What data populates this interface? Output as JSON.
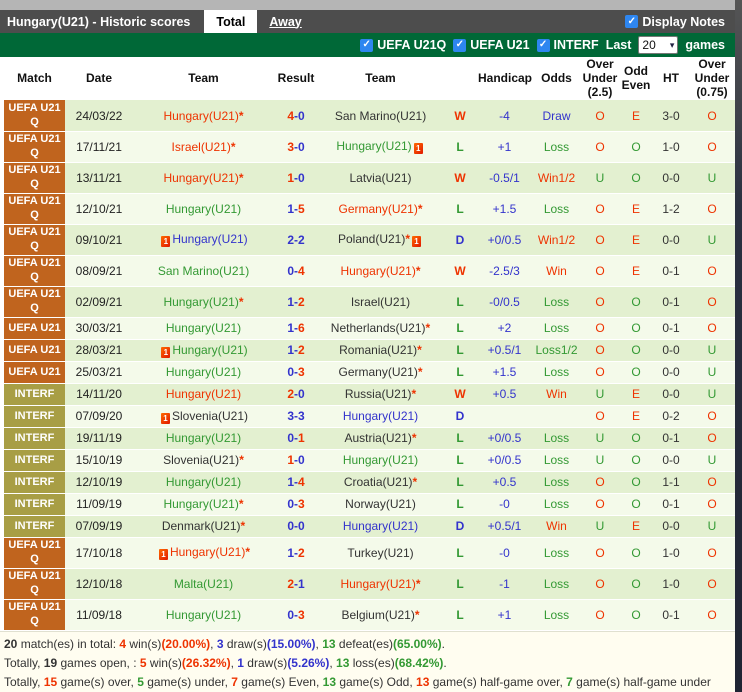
{
  "palette": {
    "red": "#ee3300",
    "green": "#339933",
    "blue": "#3333cc",
    "dark": "#333333",
    "label_orange": "#c0641e",
    "label_olive": "#a89e45",
    "title_bar": "#4d4d4d",
    "green_bar": "#006837",
    "check_blue": "#2e86f0",
    "row_dark": "#e3f0d0",
    "row_light": "#f4faea"
  },
  "icons": {
    "check": "✓",
    "select_arrow": "▾",
    "red_card_label": "1"
  },
  "header": {
    "title": "Hungary(U21) - Historic scores",
    "tabs": [
      {
        "label": "Total",
        "active": true
      },
      {
        "label": "Away",
        "active": false
      }
    ],
    "display_notes_label": "Display Notes"
  },
  "filters": {
    "items": [
      {
        "label": "UEFA U21Q",
        "checked": true
      },
      {
        "label": "UEFA U21",
        "checked": true
      },
      {
        "label": "INTERF",
        "checked": true
      }
    ],
    "last_label": "Last",
    "last_value": "20",
    "games_label": "games"
  },
  "table": {
    "columns": [
      "Match",
      "Date",
      "Team",
      "Result",
      "Team",
      "",
      "Handicap",
      "Odds",
      "Over Under (2.5)",
      "Odd Even",
      "HT",
      "Over Under (0.75)"
    ]
  },
  "rows": [
    {
      "comp": "UEFA U21 Q",
      "comp_style": "q",
      "date": "24/03/22",
      "home": {
        "name": "Hungary(U21)",
        "color": "red",
        "star": "*"
      },
      "score": {
        "home": "4",
        "away": "0",
        "home_color": "red",
        "away_color": "blue"
      },
      "away": {
        "name": "San Marino(U21)",
        "color": "dark"
      },
      "wld": {
        "text": "W",
        "color": "red"
      },
      "handicap": "-4",
      "odds": {
        "text": "Draw",
        "color": "blue"
      },
      "ou25": "O",
      "oe": "E",
      "ht": "3-0",
      "ou075": "O"
    },
    {
      "comp": "UEFA U21 Q",
      "comp_style": "q",
      "date": "17/11/21",
      "home": {
        "name": "Israel(U21)",
        "color": "red",
        "star": "*"
      },
      "score": {
        "home": "3",
        "away": "0",
        "home_color": "red",
        "away_color": "blue"
      },
      "away": {
        "name": "Hungary(U21)",
        "color": "green",
        "card_after": true
      },
      "wld": {
        "text": "L",
        "color": "green"
      },
      "handicap": "+1",
      "odds": {
        "text": "Loss",
        "color": "green"
      },
      "ou25": "O",
      "oe": "O",
      "ht": "1-0",
      "ou075": "O"
    },
    {
      "comp": "UEFA U21 Q",
      "comp_style": "q",
      "date": "13/11/21",
      "home": {
        "name": "Hungary(U21)",
        "color": "red",
        "star": "*"
      },
      "score": {
        "home": "1",
        "away": "0",
        "home_color": "red",
        "away_color": "blue"
      },
      "away": {
        "name": "Latvia(U21)",
        "color": "dark"
      },
      "wld": {
        "text": "W",
        "color": "red"
      },
      "handicap": "-0.5/1",
      "odds": {
        "text": "Win1/2",
        "color": "red"
      },
      "ou25": "U",
      "oe": "O",
      "ht": "0-0",
      "ou075": "U"
    },
    {
      "comp": "UEFA U21 Q",
      "comp_style": "q",
      "date": "12/10/21",
      "home": {
        "name": "Hungary(U21)",
        "color": "green"
      },
      "score": {
        "home": "1",
        "away": "5",
        "home_color": "blue",
        "away_color": "red"
      },
      "away": {
        "name": "Germany(U21)",
        "color": "red",
        "star": "*"
      },
      "wld": {
        "text": "L",
        "color": "green"
      },
      "handicap": "+1.5",
      "odds": {
        "text": "Loss",
        "color": "green"
      },
      "ou25": "O",
      "oe": "E",
      "ht": "1-2",
      "ou075": "O"
    },
    {
      "comp": "UEFA U21 Q",
      "comp_style": "q",
      "date": "09/10/21",
      "home": {
        "name": "Hungary(U21)",
        "color": "blue",
        "card_before": true
      },
      "score": {
        "home": "2",
        "away": "2",
        "home_color": "blue",
        "away_color": "blue"
      },
      "away": {
        "name": "Poland(U21)",
        "color": "dark",
        "star": "*",
        "card_after": true
      },
      "wld": {
        "text": "D",
        "color": "blue"
      },
      "handicap": "+0/0.5",
      "odds": {
        "text": "Win1/2",
        "color": "red"
      },
      "ou25": "O",
      "oe": "E",
      "ht": "0-0",
      "ou075": "U"
    },
    {
      "comp": "UEFA U21 Q",
      "comp_style": "q",
      "date": "08/09/21",
      "home": {
        "name": "San Marino(U21)",
        "color": "green"
      },
      "score": {
        "home": "0",
        "away": "4",
        "home_color": "blue",
        "away_color": "red"
      },
      "away": {
        "name": "Hungary(U21)",
        "color": "red",
        "star": "*"
      },
      "wld": {
        "text": "W",
        "color": "red"
      },
      "handicap": "-2.5/3",
      "odds": {
        "text": "Win",
        "color": "red"
      },
      "ou25": "O",
      "oe": "E",
      "ht": "0-1",
      "ou075": "O"
    },
    {
      "comp": "UEFA U21 Q",
      "comp_style": "q",
      "date": "02/09/21",
      "home": {
        "name": "Hungary(U21)",
        "color": "green",
        "star": "*"
      },
      "score": {
        "home": "1",
        "away": "2",
        "home_color": "blue",
        "away_color": "red"
      },
      "away": {
        "name": "Israel(U21)",
        "color": "dark"
      },
      "wld": {
        "text": "L",
        "color": "green"
      },
      "handicap": "-0/0.5",
      "odds": {
        "text": "Loss",
        "color": "green"
      },
      "ou25": "O",
      "oe": "O",
      "ht": "0-1",
      "ou075": "O"
    },
    {
      "comp": "UEFA U21",
      "comp_style": "u",
      "date": "30/03/21",
      "home": {
        "name": "Hungary(U21)",
        "color": "green"
      },
      "score": {
        "home": "1",
        "away": "6",
        "home_color": "blue",
        "away_color": "red"
      },
      "away": {
        "name": "Netherlands(U21)",
        "color": "dark",
        "star": "*"
      },
      "wld": {
        "text": "L",
        "color": "green"
      },
      "handicap": "+2",
      "odds": {
        "text": "Loss",
        "color": "green"
      },
      "ou25": "O",
      "oe": "O",
      "ht": "0-1",
      "ou075": "O"
    },
    {
      "comp": "UEFA U21",
      "comp_style": "u",
      "date": "28/03/21",
      "home": {
        "name": "Hungary(U21)",
        "color": "green",
        "card_before": true
      },
      "score": {
        "home": "1",
        "away": "2",
        "home_color": "blue",
        "away_color": "red"
      },
      "away": {
        "name": "Romania(U21)",
        "color": "dark",
        "star": "*"
      },
      "wld": {
        "text": "L",
        "color": "green"
      },
      "handicap": "+0.5/1",
      "odds": {
        "text": "Loss1/2",
        "color": "green"
      },
      "ou25": "O",
      "oe": "O",
      "ht": "0-0",
      "ou075": "U"
    },
    {
      "comp": "UEFA U21",
      "comp_style": "u",
      "date": "25/03/21",
      "home": {
        "name": "Hungary(U21)",
        "color": "green"
      },
      "score": {
        "home": "0",
        "away": "3",
        "home_color": "blue",
        "away_color": "red"
      },
      "away": {
        "name": "Germany(U21)",
        "color": "dark",
        "star": "*"
      },
      "wld": {
        "text": "L",
        "color": "green"
      },
      "handicap": "+1.5",
      "odds": {
        "text": "Loss",
        "color": "green"
      },
      "ou25": "O",
      "oe": "O",
      "ht": "0-0",
      "ou075": "U"
    },
    {
      "comp": "INTERF",
      "comp_style": "i",
      "date": "14/11/20",
      "home": {
        "name": "Hungary(U21)",
        "color": "red"
      },
      "score": {
        "home": "2",
        "away": "0",
        "home_color": "red",
        "away_color": "blue"
      },
      "away": {
        "name": "Russia(U21)",
        "color": "dark",
        "star": "*"
      },
      "wld": {
        "text": "W",
        "color": "red"
      },
      "handicap": "+0.5",
      "odds": {
        "text": "Win",
        "color": "red"
      },
      "ou25": "U",
      "oe": "E",
      "ht": "0-0",
      "ou075": "U"
    },
    {
      "comp": "INTERF",
      "comp_style": "i",
      "date": "07/09/20",
      "home": {
        "name": "Slovenia(U21)",
        "color": "dark",
        "card_before": true
      },
      "score": {
        "home": "3",
        "away": "3",
        "home_color": "blue",
        "away_color": "blue"
      },
      "away": {
        "name": "Hungary(U21)",
        "color": "blue"
      },
      "wld": {
        "text": "D",
        "color": "blue"
      },
      "handicap": "",
      "odds": {
        "text": "",
        "color": "dark"
      },
      "ou25": "O",
      "oe": "E",
      "ht": "0-2",
      "ou075": "O"
    },
    {
      "comp": "INTERF",
      "comp_style": "i",
      "date": "19/11/19",
      "home": {
        "name": "Hungary(U21)",
        "color": "green"
      },
      "score": {
        "home": "0",
        "away": "1",
        "home_color": "blue",
        "away_color": "red"
      },
      "away": {
        "name": "Austria(U21)",
        "color": "dark",
        "star": "*"
      },
      "wld": {
        "text": "L",
        "color": "green"
      },
      "handicap": "+0/0.5",
      "odds": {
        "text": "Loss",
        "color": "green"
      },
      "ou25": "U",
      "oe": "O",
      "ht": "0-1",
      "ou075": "O"
    },
    {
      "comp": "INTERF",
      "comp_style": "i",
      "date": "15/10/19",
      "home": {
        "name": "Slovenia(U21)",
        "color": "dark",
        "star": "*"
      },
      "score": {
        "home": "1",
        "away": "0",
        "home_color": "red",
        "away_color": "blue"
      },
      "away": {
        "name": "Hungary(U21)",
        "color": "green"
      },
      "wld": {
        "text": "L",
        "color": "green"
      },
      "handicap": "+0/0.5",
      "odds": {
        "text": "Loss",
        "color": "green"
      },
      "ou25": "U",
      "oe": "O",
      "ht": "0-0",
      "ou075": "U"
    },
    {
      "comp": "INTERF",
      "comp_style": "i",
      "date": "12/10/19",
      "home": {
        "name": "Hungary(U21)",
        "color": "green"
      },
      "score": {
        "home": "1",
        "away": "4",
        "home_color": "blue",
        "away_color": "red"
      },
      "away": {
        "name": "Croatia(U21)",
        "color": "dark",
        "star": "*"
      },
      "wld": {
        "text": "L",
        "color": "green"
      },
      "handicap": "+0.5",
      "odds": {
        "text": "Loss",
        "color": "green"
      },
      "ou25": "O",
      "oe": "O",
      "ht": "1-1",
      "ou075": "O"
    },
    {
      "comp": "INTERF",
      "comp_style": "i",
      "date": "11/09/19",
      "home": {
        "name": "Hungary(U21)",
        "color": "green",
        "star": "*"
      },
      "score": {
        "home": "0",
        "away": "3",
        "home_color": "blue",
        "away_color": "red"
      },
      "away": {
        "name": "Norway(U21)",
        "color": "dark"
      },
      "wld": {
        "text": "L",
        "color": "green"
      },
      "handicap": "-0",
      "odds": {
        "text": "Loss",
        "color": "green"
      },
      "ou25": "O",
      "oe": "O",
      "ht": "0-1",
      "ou075": "O"
    },
    {
      "comp": "INTERF",
      "comp_style": "i",
      "date": "07/09/19",
      "home": {
        "name": "Denmark(U21)",
        "color": "dark",
        "star": "*"
      },
      "score": {
        "home": "0",
        "away": "0",
        "home_color": "blue",
        "away_color": "blue"
      },
      "away": {
        "name": "Hungary(U21)",
        "color": "blue"
      },
      "wld": {
        "text": "D",
        "color": "blue"
      },
      "handicap": "+0.5/1",
      "odds": {
        "text": "Win",
        "color": "red"
      },
      "ou25": "U",
      "oe": "E",
      "ht": "0-0",
      "ou075": "U"
    },
    {
      "comp": "UEFA U21 Q",
      "comp_style": "q",
      "date": "17/10/18",
      "home": {
        "name": "Hungary(U21)",
        "color": "red",
        "star": "*",
        "card_before": true
      },
      "score": {
        "home": "1",
        "away": "2",
        "home_color": "blue",
        "away_color": "red"
      },
      "away": {
        "name": "Turkey(U21)",
        "color": "dark"
      },
      "wld": {
        "text": "L",
        "color": "green"
      },
      "handicap": "-0",
      "odds": {
        "text": "Loss",
        "color": "green"
      },
      "ou25": "O",
      "oe": "O",
      "ht": "1-0",
      "ou075": "O"
    },
    {
      "comp": "UEFA U21 Q",
      "comp_style": "q",
      "date": "12/10/18",
      "home": {
        "name": "Malta(U21)",
        "color": "green"
      },
      "score": {
        "home": "2",
        "away": "1",
        "home_color": "red",
        "away_color": "blue"
      },
      "away": {
        "name": "Hungary(U21)",
        "color": "red",
        "star": "*"
      },
      "wld": {
        "text": "L",
        "color": "green"
      },
      "handicap": "-1",
      "odds": {
        "text": "Loss",
        "color": "green"
      },
      "ou25": "O",
      "oe": "O",
      "ht": "1-0",
      "ou075": "O"
    },
    {
      "comp": "UEFA U21 Q",
      "comp_style": "q",
      "date": "11/09/18",
      "home": {
        "name": "Hungary(U21)",
        "color": "green"
      },
      "score": {
        "home": "0",
        "away": "3",
        "home_color": "blue",
        "away_color": "red"
      },
      "away": {
        "name": "Belgium(U21)",
        "color": "dark",
        "star": "*"
      },
      "wld": {
        "text": "L",
        "color": "green"
      },
      "handicap": "+1",
      "odds": {
        "text": "Loss",
        "color": "green"
      },
      "ou25": "O",
      "oe": "O",
      "ht": "0-1",
      "ou075": "O"
    }
  ],
  "summary": {
    "lines": [
      {
        "segments": [
          {
            "text": "20",
            "color": "dark",
            "bold": true
          },
          {
            "text": " match(es) in total: ",
            "color": "dark"
          },
          {
            "text": "4",
            "color": "red",
            "bold": true
          },
          {
            "text": " win(s)",
            "color": "dark"
          },
          {
            "text": "(20.00%)",
            "color": "red",
            "bold": true
          },
          {
            "text": ", ",
            "color": "dark"
          },
          {
            "text": "3",
            "color": "blue",
            "bold": true
          },
          {
            "text": " draw(s)",
            "color": "dark"
          },
          {
            "text": "(15.00%)",
            "color": "blue",
            "bold": true
          },
          {
            "text": ", ",
            "color": "dark"
          },
          {
            "text": "13",
            "color": "green",
            "bold": true
          },
          {
            "text": " defeat(es)",
            "color": "dark"
          },
          {
            "text": "(65.00%)",
            "color": "green",
            "bold": true
          },
          {
            "text": ".",
            "color": "dark"
          }
        ]
      },
      {
        "segments": [
          {
            "text": "Totally, ",
            "color": "dark"
          },
          {
            "text": "19",
            "color": "dark",
            "bold": true
          },
          {
            "text": " games open, : ",
            "color": "dark"
          },
          {
            "text": "5",
            "color": "red",
            "bold": true
          },
          {
            "text": " win(s)",
            "color": "dark"
          },
          {
            "text": "(26.32%)",
            "color": "red",
            "bold": true
          },
          {
            "text": ", ",
            "color": "dark"
          },
          {
            "text": "1",
            "color": "blue",
            "bold": true
          },
          {
            "text": " draw(s)",
            "color": "dark"
          },
          {
            "text": "(5.26%)",
            "color": "blue",
            "bold": true
          },
          {
            "text": ", ",
            "color": "dark"
          },
          {
            "text": "13",
            "color": "green",
            "bold": true
          },
          {
            "text": " loss(es)",
            "color": "dark"
          },
          {
            "text": "(68.42%)",
            "color": "green",
            "bold": true
          },
          {
            "text": ".",
            "color": "dark"
          }
        ]
      },
      {
        "segments": [
          {
            "text": "Totally, ",
            "color": "dark"
          },
          {
            "text": "15",
            "color": "red",
            "bold": true
          },
          {
            "text": " game(s) over, ",
            "color": "dark"
          },
          {
            "text": "5",
            "color": "green",
            "bold": true
          },
          {
            "text": " game(s) under, ",
            "color": "dark"
          },
          {
            "text": "7",
            "color": "red",
            "bold": true
          },
          {
            "text": " game(s) Even, ",
            "color": "dark"
          },
          {
            "text": "13",
            "color": "green",
            "bold": true
          },
          {
            "text": " game(s) Odd, ",
            "color": "dark"
          },
          {
            "text": "13",
            "color": "red",
            "bold": true
          },
          {
            "text": " game(s) half-game over, ",
            "color": "dark"
          },
          {
            "text": "7",
            "color": "green",
            "bold": true
          },
          {
            "text": " game(s) half-game under",
            "color": "dark"
          }
        ]
      }
    ]
  }
}
